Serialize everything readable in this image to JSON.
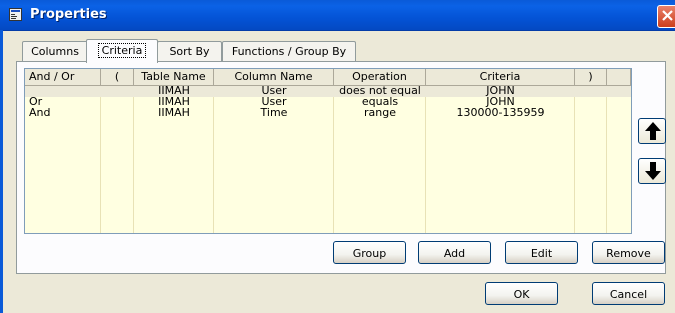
{
  "window": {
    "title": "Properties"
  },
  "tabs": [
    {
      "label": "Columns"
    },
    {
      "label": "Criteria"
    },
    {
      "label": "Sort By"
    },
    {
      "label": "Functions / Group By"
    }
  ],
  "table": {
    "headers": [
      "And / Or",
      "(",
      "Table Name",
      "Column Name",
      "Operation",
      "Criteria",
      ")"
    ],
    "rows": [
      {
        "and_or": "",
        "open": "",
        "table_name": "IIMAH",
        "column_name": "User",
        "operation": "does not equal",
        "criteria": "JOHN",
        "close": ""
      },
      {
        "and_or": "Or",
        "open": "",
        "table_name": "IIMAH",
        "column_name": "User",
        "operation": "equals",
        "criteria": "JOHN",
        "close": ""
      },
      {
        "and_or": "And",
        "open": "",
        "table_name": "IIMAH",
        "column_name": "Time",
        "operation": "range",
        "criteria": "130000-135959",
        "close": ""
      }
    ]
  },
  "buttons": {
    "group": "Group",
    "add": "Add",
    "edit": "Edit",
    "remove": "Remove",
    "ok": "OK",
    "cancel": "Cancel"
  },
  "icons": {
    "window_icon": "properties-window-icon",
    "move_up": "arrow-up-icon",
    "move_down": "arrow-down-icon",
    "close": "close-icon"
  },
  "colors": {
    "titlebar": "#0a5ad8",
    "list_background": "#ffffe1",
    "dialog_background": "#ece9d8"
  }
}
